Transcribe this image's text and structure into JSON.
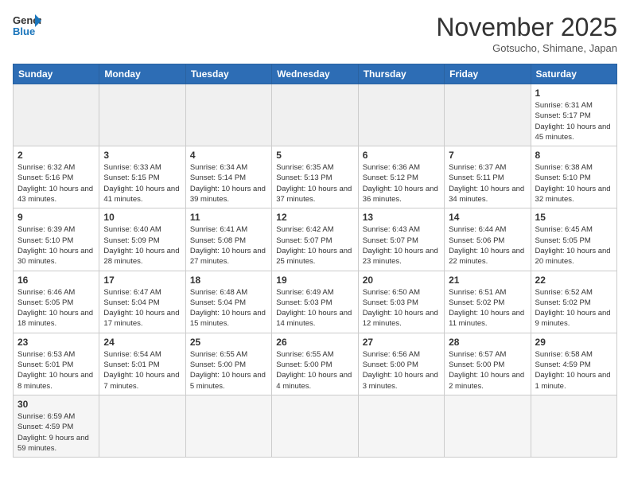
{
  "header": {
    "logo_text_general": "General",
    "logo_text_blue": "Blue",
    "month_title": "November 2025",
    "subtitle": "Gotsucho, Shimane, Japan"
  },
  "weekdays": [
    "Sunday",
    "Monday",
    "Tuesday",
    "Wednesday",
    "Thursday",
    "Friday",
    "Saturday"
  ],
  "weeks": [
    [
      {
        "day": "",
        "empty": true
      },
      {
        "day": "",
        "empty": true
      },
      {
        "day": "",
        "empty": true
      },
      {
        "day": "",
        "empty": true
      },
      {
        "day": "",
        "empty": true
      },
      {
        "day": "",
        "empty": true
      },
      {
        "day": "1",
        "info": "Sunrise: 6:31 AM\nSunset: 5:17 PM\nDaylight: 10 hours and 45 minutes."
      }
    ],
    [
      {
        "day": "2",
        "info": "Sunrise: 6:32 AM\nSunset: 5:16 PM\nDaylight: 10 hours and 43 minutes."
      },
      {
        "day": "3",
        "info": "Sunrise: 6:33 AM\nSunset: 5:15 PM\nDaylight: 10 hours and 41 minutes."
      },
      {
        "day": "4",
        "info": "Sunrise: 6:34 AM\nSunset: 5:14 PM\nDaylight: 10 hours and 39 minutes."
      },
      {
        "day": "5",
        "info": "Sunrise: 6:35 AM\nSunset: 5:13 PM\nDaylight: 10 hours and 37 minutes."
      },
      {
        "day": "6",
        "info": "Sunrise: 6:36 AM\nSunset: 5:12 PM\nDaylight: 10 hours and 36 minutes."
      },
      {
        "day": "7",
        "info": "Sunrise: 6:37 AM\nSunset: 5:11 PM\nDaylight: 10 hours and 34 minutes."
      },
      {
        "day": "8",
        "info": "Sunrise: 6:38 AM\nSunset: 5:10 PM\nDaylight: 10 hours and 32 minutes."
      }
    ],
    [
      {
        "day": "9",
        "info": "Sunrise: 6:39 AM\nSunset: 5:10 PM\nDaylight: 10 hours and 30 minutes."
      },
      {
        "day": "10",
        "info": "Sunrise: 6:40 AM\nSunset: 5:09 PM\nDaylight: 10 hours and 28 minutes."
      },
      {
        "day": "11",
        "info": "Sunrise: 6:41 AM\nSunset: 5:08 PM\nDaylight: 10 hours and 27 minutes."
      },
      {
        "day": "12",
        "info": "Sunrise: 6:42 AM\nSunset: 5:07 PM\nDaylight: 10 hours and 25 minutes."
      },
      {
        "day": "13",
        "info": "Sunrise: 6:43 AM\nSunset: 5:07 PM\nDaylight: 10 hours and 23 minutes."
      },
      {
        "day": "14",
        "info": "Sunrise: 6:44 AM\nSunset: 5:06 PM\nDaylight: 10 hours and 22 minutes."
      },
      {
        "day": "15",
        "info": "Sunrise: 6:45 AM\nSunset: 5:05 PM\nDaylight: 10 hours and 20 minutes."
      }
    ],
    [
      {
        "day": "16",
        "info": "Sunrise: 6:46 AM\nSunset: 5:05 PM\nDaylight: 10 hours and 18 minutes."
      },
      {
        "day": "17",
        "info": "Sunrise: 6:47 AM\nSunset: 5:04 PM\nDaylight: 10 hours and 17 minutes."
      },
      {
        "day": "18",
        "info": "Sunrise: 6:48 AM\nSunset: 5:04 PM\nDaylight: 10 hours and 15 minutes."
      },
      {
        "day": "19",
        "info": "Sunrise: 6:49 AM\nSunset: 5:03 PM\nDaylight: 10 hours and 14 minutes."
      },
      {
        "day": "20",
        "info": "Sunrise: 6:50 AM\nSunset: 5:03 PM\nDaylight: 10 hours and 12 minutes."
      },
      {
        "day": "21",
        "info": "Sunrise: 6:51 AM\nSunset: 5:02 PM\nDaylight: 10 hours and 11 minutes."
      },
      {
        "day": "22",
        "info": "Sunrise: 6:52 AM\nSunset: 5:02 PM\nDaylight: 10 hours and 9 minutes."
      }
    ],
    [
      {
        "day": "23",
        "info": "Sunrise: 6:53 AM\nSunset: 5:01 PM\nDaylight: 10 hours and 8 minutes."
      },
      {
        "day": "24",
        "info": "Sunrise: 6:54 AM\nSunset: 5:01 PM\nDaylight: 10 hours and 7 minutes."
      },
      {
        "day": "25",
        "info": "Sunrise: 6:55 AM\nSunset: 5:00 PM\nDaylight: 10 hours and 5 minutes."
      },
      {
        "day": "26",
        "info": "Sunrise: 6:55 AM\nSunset: 5:00 PM\nDaylight: 10 hours and 4 minutes."
      },
      {
        "day": "27",
        "info": "Sunrise: 6:56 AM\nSunset: 5:00 PM\nDaylight: 10 hours and 3 minutes."
      },
      {
        "day": "28",
        "info": "Sunrise: 6:57 AM\nSunset: 5:00 PM\nDaylight: 10 hours and 2 minutes."
      },
      {
        "day": "29",
        "info": "Sunrise: 6:58 AM\nSunset: 4:59 PM\nDaylight: 10 hours and 1 minute."
      }
    ],
    [
      {
        "day": "30",
        "info": "Sunrise: 6:59 AM\nSunset: 4:59 PM\nDaylight: 9 hours and 59 minutes.",
        "last": true
      },
      {
        "day": "",
        "empty": true
      },
      {
        "day": "",
        "empty": true
      },
      {
        "day": "",
        "empty": true
      },
      {
        "day": "",
        "empty": true
      },
      {
        "day": "",
        "empty": true
      },
      {
        "day": "",
        "empty": true
      }
    ]
  ]
}
